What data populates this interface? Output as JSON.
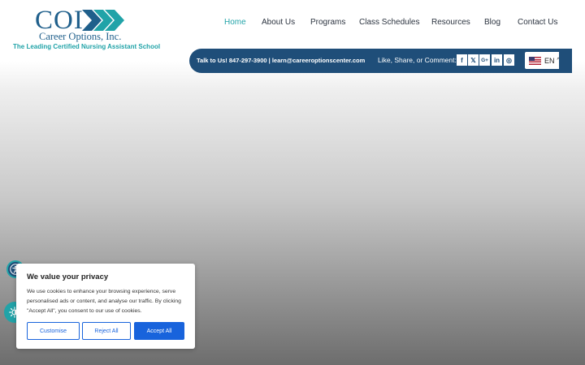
{
  "logo": {
    "main": "COI",
    "name": "Career Options, Inc.",
    "tagline": "The Leading Certified Nursing Assistant School",
    "colors": {
      "primary": "#1f5f8b",
      "accent": "#21a3a8"
    }
  },
  "nav": {
    "items": [
      {
        "label": "Home",
        "active": true
      },
      {
        "label": "About Us"
      },
      {
        "label": "Programs"
      },
      {
        "label": "Class Schedules"
      },
      {
        "label": "Resources"
      },
      {
        "label": "Blog"
      },
      {
        "label": "Contact Us"
      }
    ]
  },
  "contact_bar": {
    "text": "Talk to Us! 847-297-3900 | learn@careeroptionscenter.com",
    "share_label": "Like, Share, or Comment:",
    "social": [
      {
        "icon": "facebook-icon",
        "glyph": "f"
      },
      {
        "icon": "x-icon",
        "glyph": "𝕏"
      },
      {
        "icon": "google-plus-icon",
        "glyph": "G+"
      },
      {
        "icon": "linkedin-icon",
        "glyph": "in"
      },
      {
        "icon": "instagram-icon",
        "glyph": "◎"
      }
    ],
    "language": {
      "code": "EN",
      "flag": "us-flag-icon",
      "chevron": "^"
    },
    "color": "#1f4e79"
  },
  "cookie": {
    "title": "We value your privacy",
    "text": "We use cookies to enhance your browsing experience, serve personalised ads or content, and analyse our traffic. By clicking \"Accept All\", you consent to our use of cookies.",
    "buttons": {
      "customise": "Customise",
      "reject": "Reject All",
      "accept": "Accept All"
    },
    "button_color": "#1863dc"
  },
  "widgets": {
    "accessibility_icon": "accessibility-icon",
    "theme_icon": "brightness-icon"
  }
}
